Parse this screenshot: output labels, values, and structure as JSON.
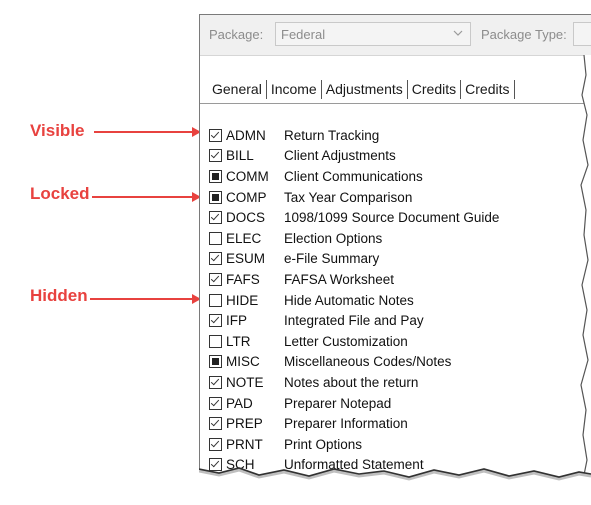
{
  "annotations": [
    {
      "label": "Visible"
    },
    {
      "label": "Locked"
    },
    {
      "label": "Hidden"
    }
  ],
  "toolbar": {
    "package_label": "Package:",
    "package_value": "Federal",
    "package_type_label": "Package Type:"
  },
  "tabs": [
    "General",
    "Income",
    "Adjustments",
    "Credits",
    "Credits"
  ],
  "rows": [
    {
      "code": "ADMN",
      "desc": "Return Tracking",
      "state": "checked"
    },
    {
      "code": "BILL",
      "desc": "Client Adjustments",
      "state": "checked"
    },
    {
      "code": "COMM",
      "desc": "Client Communications",
      "state": "locked"
    },
    {
      "code": "COMP",
      "desc": "Tax Year Comparison",
      "state": "locked"
    },
    {
      "code": "DOCS",
      "desc": "1098/1099 Source Document Guide",
      "state": "checked"
    },
    {
      "code": "ELEC",
      "desc": "Election Options",
      "state": "unchecked"
    },
    {
      "code": "ESUM",
      "desc": "e-File Summary",
      "state": "checked"
    },
    {
      "code": "FAFS",
      "desc": "FAFSA Worksheet",
      "state": "checked"
    },
    {
      "code": "HIDE",
      "desc": "Hide Automatic Notes",
      "state": "unchecked"
    },
    {
      "code": "IFP",
      "desc": "Integrated File and Pay",
      "state": "checked"
    },
    {
      "code": "LTR",
      "desc": "Letter Customization",
      "state": "unchecked"
    },
    {
      "code": "MISC",
      "desc": "Miscellaneous Codes/Notes",
      "state": "locked"
    },
    {
      "code": "NOTE",
      "desc": "Notes about the return",
      "state": "checked"
    },
    {
      "code": "PAD",
      "desc": "Preparer Notepad",
      "state": "checked"
    },
    {
      "code": "PREP",
      "desc": "Preparer Information",
      "state": "checked"
    },
    {
      "code": "PRNT",
      "desc": "Print Options",
      "state": "checked"
    },
    {
      "code": "SCH",
      "desc": "Unformatted Statement",
      "state": "checked"
    }
  ],
  "colors": {
    "annotation": "#e8423f"
  }
}
